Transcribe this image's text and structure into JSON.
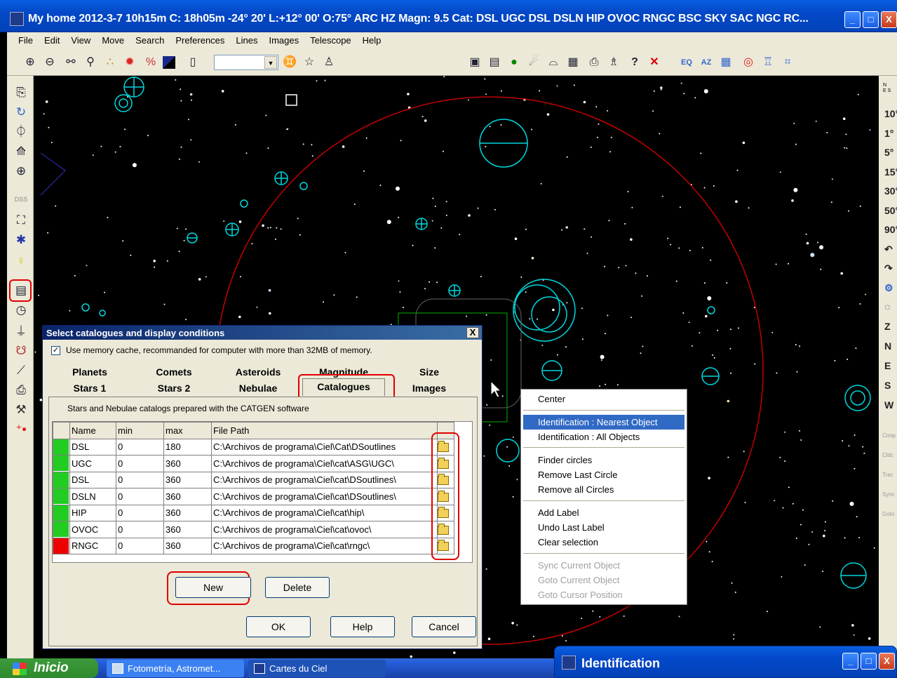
{
  "window": {
    "title": "My home 2012-3-7  10h15m C: 18h05m -24° 20' L:+12° 00' O:75° ARC HZ  Magn: 9.5 Cat: DSL UGC DSL DSLN HIP OVOC RNGC BSC SKY SAC NGC RC...",
    "minimize": "_",
    "maximize": "□",
    "close": "X"
  },
  "menu": [
    "File",
    "Edit",
    "View",
    "Move",
    "Search",
    "Preferences",
    "Lines",
    "Images",
    "Telescope",
    "Help"
  ],
  "toolbar": {
    "icons": [
      "zoom-in-icon",
      "zoom-out-icon",
      "binoculars-icon",
      "magnifier-icon",
      "constellation-icon",
      "star-icon",
      "percent-icon",
      "contrast-icon",
      "page-icon"
    ],
    "right_icons": [
      "save-icon",
      "document-icon",
      "planet-icon",
      "comet-icon",
      "chart-icon",
      "calendar-icon",
      "print-icon",
      "print-setup-icon",
      "help-icon",
      "close-icon",
      "eq-grid-icon",
      "az-grid-icon",
      "grid-icon",
      "target-icon",
      "telescope-icon",
      "mount-icon"
    ],
    "eq_label": "EQ",
    "az_label": "AZ",
    "zoom_value": "",
    "help_glyph": "?",
    "close_glyph": "✕"
  },
  "right_strip": {
    "labels": [
      "10°",
      "1°",
      "5°",
      "15°",
      "30°",
      "50°",
      "90°",
      "Z",
      "N",
      "E",
      "S",
      "W"
    ],
    "small_labels": [
      "Coop",
      "Cldc",
      "Trac",
      "Sync",
      "Goto"
    ]
  },
  "dialog": {
    "title": "Select catalogues and display conditions",
    "close": "X",
    "memory_cache_label": "Use memory cache, recommanded for computer with more than 32MB of memory.",
    "memory_cache_checked": "✓",
    "tabs_row1": [
      "Planets",
      "Comets",
      "Asteroids",
      "Magnitude",
      "Size"
    ],
    "tabs_row2": [
      "Stars 1",
      "Stars 2",
      "Nebulae",
      "Catalogues",
      "Images"
    ],
    "selected_tab": "Catalogues",
    "catalog_desc": "Stars and Nebulae catalogs prepared with the CATGEN software",
    "columns": [
      "Name",
      "min",
      "max",
      "File Path"
    ],
    "rows": [
      {
        "name": "DSL",
        "min": "0",
        "max": "180",
        "path": "C:\\Archivos de programa\\Ciel\\Cat\\DSoutlines",
        "color": "#22cc22"
      },
      {
        "name": "UGC",
        "min": "0",
        "max": "360",
        "path": "C:\\Archivos de programa\\Ciel\\cat\\ASG\\UGC\\",
        "color": "#22cc22"
      },
      {
        "name": "DSL",
        "min": "0",
        "max": "360",
        "path": "C:\\Archivos de programa\\Ciel\\cat\\DSoutlines\\",
        "color": "#22cc22"
      },
      {
        "name": "DSLN",
        "min": "0",
        "max": "360",
        "path": "C:\\Archivos de programa\\Ciel\\cat\\DSoutlines\\",
        "color": "#22cc22"
      },
      {
        "name": "HIP",
        "min": "0",
        "max": "360",
        "path": "C:\\Archivos de programa\\Ciel\\cat\\hip\\",
        "color": "#22cc22"
      },
      {
        "name": "OVOC",
        "min": "0",
        "max": "360",
        "path": "C:\\Archivos de programa\\Ciel\\cat\\ovoc\\",
        "color": "#22cc22"
      },
      {
        "name": "RNGC",
        "min": "0",
        "max": "360",
        "path": "C:\\Archivos de programa\\Ciel\\cat\\rngc\\",
        "color": "#ee0000"
      }
    ],
    "new_label": "New",
    "delete_label": "Delete",
    "ok_label": "OK",
    "help_label": "Help",
    "cancel_label": "Cancel"
  },
  "context_menu": {
    "center": "Center",
    "ident_nearest": "Identification : Nearest Object",
    "ident_all": "Identification : All Objects",
    "finder_circles": "Finder circles",
    "remove_last_circle": "Remove Last Circle",
    "remove_all_circles": "Remove all Circles",
    "add_label": "Add Label",
    "undo_last_label": "Undo Last Label",
    "clear_selection": "Clear selection",
    "sync_current": "Sync Current Object",
    "goto_current": "Goto Current Object",
    "goto_cursor": "Goto Cursor Position"
  },
  "taskbar": {
    "start": "Inicio",
    "items": [
      "Fotometría, Astromet...",
      "Cartes du Ciel"
    ]
  },
  "identification_window": {
    "title": "Identification"
  },
  "colors": {
    "annotation_red": "#e00000",
    "object_cyan": "#00d8e0",
    "horizon_red": "#c00000",
    "selection_green": "#00c000"
  }
}
